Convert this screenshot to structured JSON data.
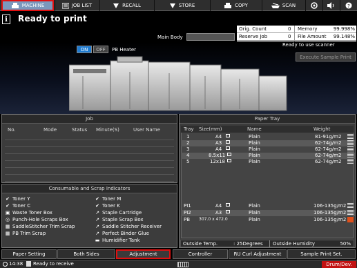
{
  "nav": {
    "tabs": [
      {
        "label": "MACHINE",
        "icon": "printer-icon",
        "active": true
      },
      {
        "label": "JOB LIST",
        "icon": "list-icon"
      },
      {
        "label": "RECALL",
        "icon": "recall-icon"
      },
      {
        "label": "STORE",
        "icon": "store-icon"
      },
      {
        "label": "COPY",
        "icon": "copy-icon"
      },
      {
        "label": "SCAN",
        "icon": "scan-icon"
      }
    ],
    "right_icons": [
      "settings-icon",
      "volume-icon",
      "help-icon"
    ]
  },
  "header": {
    "status": "Ready to print",
    "main_body_label": "Main Body",
    "ready_scanner": "Ready to use scanner",
    "exec_sample": "Execute Sample Print"
  },
  "counters": {
    "orig_count_label": "Orig. Count",
    "orig_count_value": "0",
    "reserve_job_label": "Reserve Job",
    "reserve_job_value": "0",
    "memory_label": "Memory",
    "memory_value": "99.998%",
    "file_amount_label": "File Amount",
    "file_amount_value": "99.148%"
  },
  "pb_heater": {
    "on": "ON",
    "off": "OFF",
    "label": "PB Heater",
    "state": "on"
  },
  "job_panel": {
    "title": "Job",
    "columns": [
      "No.",
      "Mode",
      "Status",
      "Minute(S)",
      "User Name"
    ]
  },
  "consumables": {
    "title": "Consumable and Scrap Indicators",
    "left": [
      {
        "label": "Toner Y",
        "icon": "toner-icon"
      },
      {
        "label": "Toner C",
        "icon": "toner-icon"
      },
      {
        "label": "Waste Toner Box",
        "icon": "waste-box-icon"
      },
      {
        "label": "Punch-Hole Scraps Box",
        "icon": "punch-icon"
      },
      {
        "label": "SaddleStitcher Trim Scrap",
        "icon": "scrap-icon"
      },
      {
        "label": "PB Trim Scrap",
        "icon": "scrap-icon"
      }
    ],
    "right": [
      {
        "label": "Toner M",
        "icon": "toner-icon"
      },
      {
        "label": "Toner K",
        "icon": "toner-icon"
      },
      {
        "label": "Staple Cartridge",
        "icon": "staple-icon"
      },
      {
        "label": "Staple Scrap Box",
        "icon": "staple-icon"
      },
      {
        "label": "Saddle Stitcher Receiver",
        "icon": "receiver-icon"
      },
      {
        "label": "Perfect Binder Glue",
        "icon": "glue-icon"
      },
      {
        "label": "Humidifier Tank",
        "icon": "tank-icon"
      }
    ]
  },
  "paper_tray": {
    "title": "Paper Tray",
    "columns": [
      "Tray",
      "Size(mm)",
      "Name",
      "Weight"
    ],
    "rows": [
      {
        "tray": "1",
        "size": "A4",
        "name": "Plain",
        "weight": "81-91g/m2"
      },
      {
        "tray": "2",
        "size": "A3",
        "name": "Plain",
        "weight": "62-74g/m2"
      },
      {
        "tray": "3",
        "size": "A4",
        "name": "Plain",
        "weight": "62-74g/m2"
      },
      {
        "tray": "4",
        "size": "8.5x11",
        "name": "Plain",
        "weight": "62-74g/m2"
      },
      {
        "tray": "5",
        "size": "12x18",
        "name": "Plain",
        "weight": "62-74g/m2"
      }
    ],
    "lower_rows": [
      {
        "tray": "PI1",
        "size": "A4",
        "name": "Plain",
        "weight": "106-135g/m2"
      },
      {
        "tray": "PI2",
        "size": "A3",
        "name": "Plain",
        "weight": "106-135g/m2"
      },
      {
        "tray": "PB",
        "size": "307.0 x 472.0",
        "name": "Plain",
        "weight": "106-135g/m2"
      }
    ],
    "outside_temp_label": "Outside Temp.",
    "outside_temp_value": ":  25Degrees",
    "outside_humidity_label": "Outside Humidity",
    "outside_humidity_value": "50%"
  },
  "bottom_tabs": [
    {
      "label": "Paper Setting"
    },
    {
      "label": "Both Sides"
    },
    {
      "label": "Adjustment",
      "selected": true
    },
    {
      "label": "Controller"
    },
    {
      "label": "RU Curl Adjustment"
    },
    {
      "label": "Sample Print Set."
    }
  ],
  "status_bar": {
    "time": "14:38",
    "message": "Ready to receive",
    "right_label": "Drum/Dev."
  }
}
